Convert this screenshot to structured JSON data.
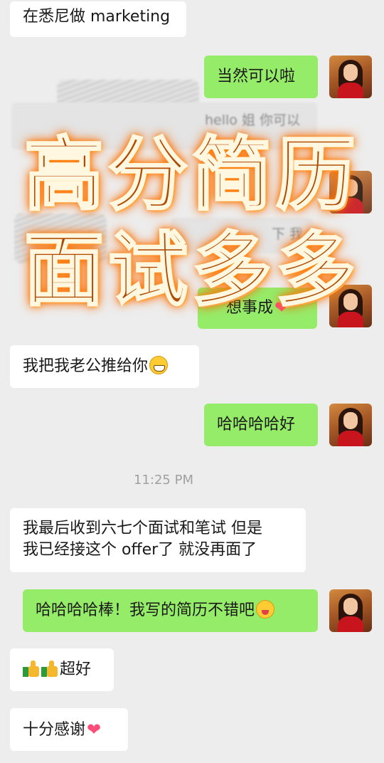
{
  "messages": {
    "m1": "在悉尼做 marketing",
    "m2": "当然可以啦",
    "m_blur1": "hello 姐 你可以",
    "m_blur2": "下 我",
    "m_blur3": "想事成",
    "m3": "我把我老公推给你",
    "m4": "哈哈哈哈好",
    "m5_line1": "我最后收到六七个面试和笔试 但是",
    "m5_line2": "我已经接这个 offer了 就没再面了",
    "m6": "哈哈哈哈棒！我写的简历不错吧",
    "m7": "超好",
    "m8": "十分感谢"
  },
  "timestamp": "11:25 PM",
  "overlay": {
    "line1": "高分简历",
    "line2": "面试多多"
  },
  "colors": {
    "chat_bg": "#ededed",
    "outgoing_bubble": "#95ec69",
    "incoming_bubble": "#ffffff",
    "overlay_text": "#b04a00",
    "overlay_glow": "#ff7000"
  },
  "icons": [
    "grinning-emoji-icon",
    "winking-tongue-emoji-icon",
    "heart-icon",
    "thumbs-up-icon"
  ]
}
